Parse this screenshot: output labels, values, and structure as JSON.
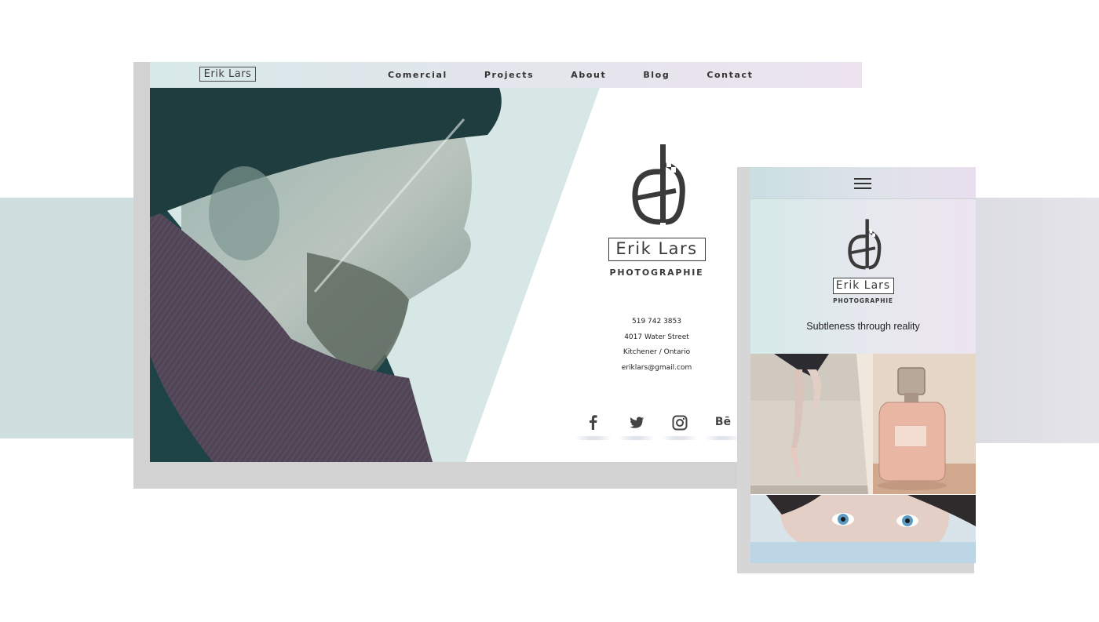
{
  "desktop": {
    "nav": {
      "logo_text": "Erik Lars",
      "links": [
        "Comercial",
        "Projects",
        "About",
        "Blog",
        "Contact"
      ]
    },
    "brand": {
      "name": "Erik Lars",
      "subtitle": "PHOTOGRAPHIE"
    },
    "contact": {
      "phone": "519 742 3853",
      "street": "4017 Water Street",
      "city": "Kitchener / Ontario",
      "email": "eriklars@gmail.com"
    },
    "social": [
      "facebook-icon",
      "twitter-icon",
      "instagram-icon",
      "behance-icon"
    ],
    "behance_glyph": "Bē"
  },
  "mobile": {
    "brand": {
      "name": "Erik Lars",
      "subtitle": "PHOTOGRAPHIE",
      "tagline": "Subtleness through reality"
    },
    "menu_icon": "hamburger-menu-icon"
  },
  "colors": {
    "teal_band": "#cfdfe0",
    "nav_gradient_start": "#d8e9ea",
    "nav_gradient_end": "#ece3ef",
    "text_dark": "#3a3a3a"
  }
}
